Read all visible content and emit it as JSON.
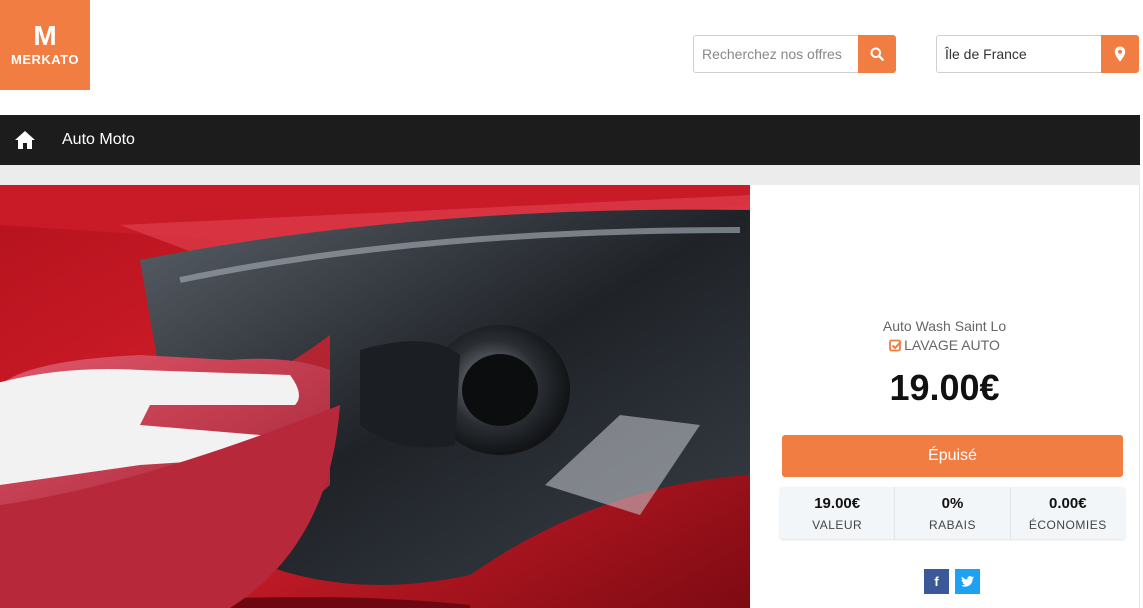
{
  "brand": {
    "logo_letter": "M",
    "name": "MERKATO"
  },
  "search": {
    "placeholder": "Recherchez nos offres",
    "icon": "search-icon"
  },
  "location": {
    "value": "Île de France",
    "icon": "map-pin-icon"
  },
  "nav": {
    "home_icon": "home-icon",
    "items": [
      {
        "label": "Auto Moto"
      }
    ]
  },
  "offer": {
    "merchant": "Auto Wash Saint Lo",
    "category": "LAVAGE AUTO",
    "price": "19.00€",
    "status_label": "Épuisé",
    "stats": [
      {
        "value": "19.00€",
        "label": "VALEUR"
      },
      {
        "value": "0%",
        "label": "RABAIS"
      },
      {
        "value": "0.00€",
        "label": "ÉCONOMIES"
      }
    ],
    "share": {
      "facebook": "f"
    }
  },
  "colors": {
    "accent": "#f27d42",
    "nav_bg": "#1c1c1c",
    "facebook": "#3b5998",
    "twitter": "#1da1f2"
  }
}
